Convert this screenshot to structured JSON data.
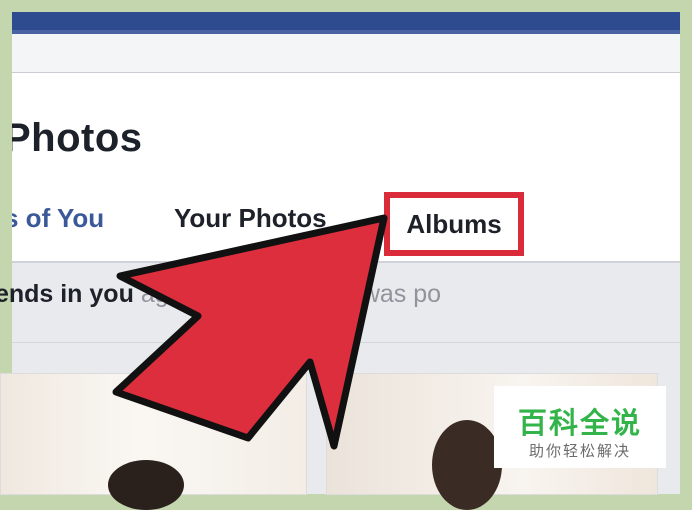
{
  "header": {
    "title": "Photos"
  },
  "tabs": [
    {
      "label": "s of You"
    },
    {
      "label": "Your Photos"
    },
    {
      "label": "Albums"
    }
  ],
  "info": {
    "bold_text": "iends in you",
    "rest_text": "agging a photo that was po"
  },
  "watermark": {
    "title": "百科全说",
    "subtitle": "助你轻松解决"
  },
  "colors": {
    "navbar": "#2f4b8f",
    "tab_link": "#3b5998",
    "highlight": "#d92b3a",
    "watermark_green": "#32b44a",
    "background": "#c3d6ad"
  }
}
